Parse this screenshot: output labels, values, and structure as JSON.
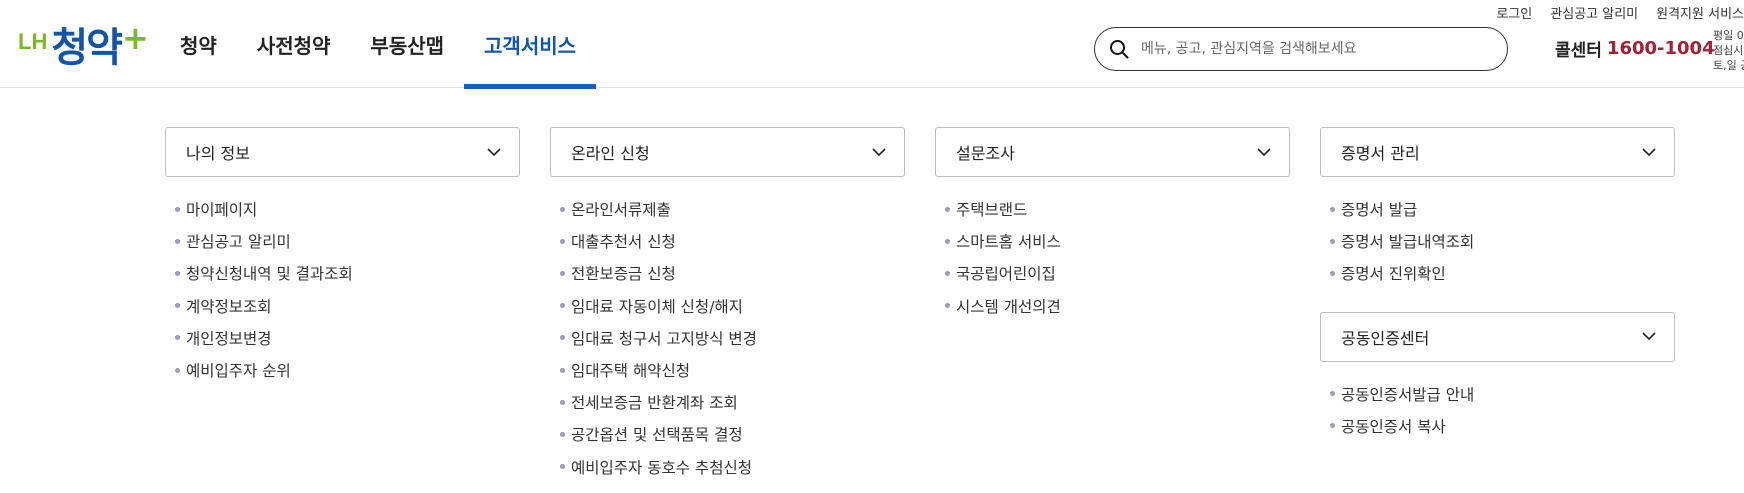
{
  "logo": {
    "lh": "LH",
    "name": "청약",
    "plus": "+"
  },
  "gnb": [
    {
      "label": "청약"
    },
    {
      "label": "사전청약"
    },
    {
      "label": "부동산맵"
    },
    {
      "label": "고객서비스"
    }
  ],
  "gnb_active_index": 3,
  "utils": {
    "login": "로그인",
    "alert": "관심공고 알리미",
    "remote": "원격지원 서비스"
  },
  "search": {
    "placeholder": "메뉴, 공고, 관심지역을 검색해보세요",
    "value": ""
  },
  "callcenter": {
    "label": "콜센터",
    "number": "1600-1004",
    "sep": "|",
    "hours_lines": [
      "평일 0",
      "점심시",
      "토,일 공"
    ]
  },
  "columns": [
    {
      "title": "나의 정보",
      "items": [
        "마이페이지",
        "관심공고 알리미",
        "청약신청내역 및 결과조회",
        "계약정보조회",
        "개인정보변경",
        "예비입주자 순위"
      ]
    },
    {
      "title": "온라인 신청",
      "items": [
        "온라인서류제출",
        "대출추천서 신청",
        "전환보증금 신청",
        "임대료 자동이체 신청/해지",
        "임대료 청구서 고지방식 변경",
        "임대주택 해약신청",
        "전세보증금 반환계좌 조회",
        "공간옵션 및 선택품목 결정",
        "예비입주자 동호수 추첨신청"
      ]
    },
    {
      "title": "설문조사",
      "items": [
        "주택브랜드",
        "스마트홈 서비스",
        "국공립어린이집",
        "시스템 개선의견"
      ]
    },
    {
      "title": "증명서 관리",
      "items": [
        "증명서 발급",
        "증명서 발급내역조회",
        "증명서 진위확인"
      ]
    }
  ],
  "extra_column": {
    "title": "공동인증센터",
    "items": [
      "공동인증서발급 안내",
      "공동인증서 복사"
    ]
  },
  "colors": {
    "brand_blue": "#1254a5",
    "brand_green": "#7bb928",
    "phone_red": "#a32035",
    "bullet": "#9c9cbf"
  },
  "icons": {
    "search": "search-icon",
    "dropdown": "chevron-down-icon"
  }
}
